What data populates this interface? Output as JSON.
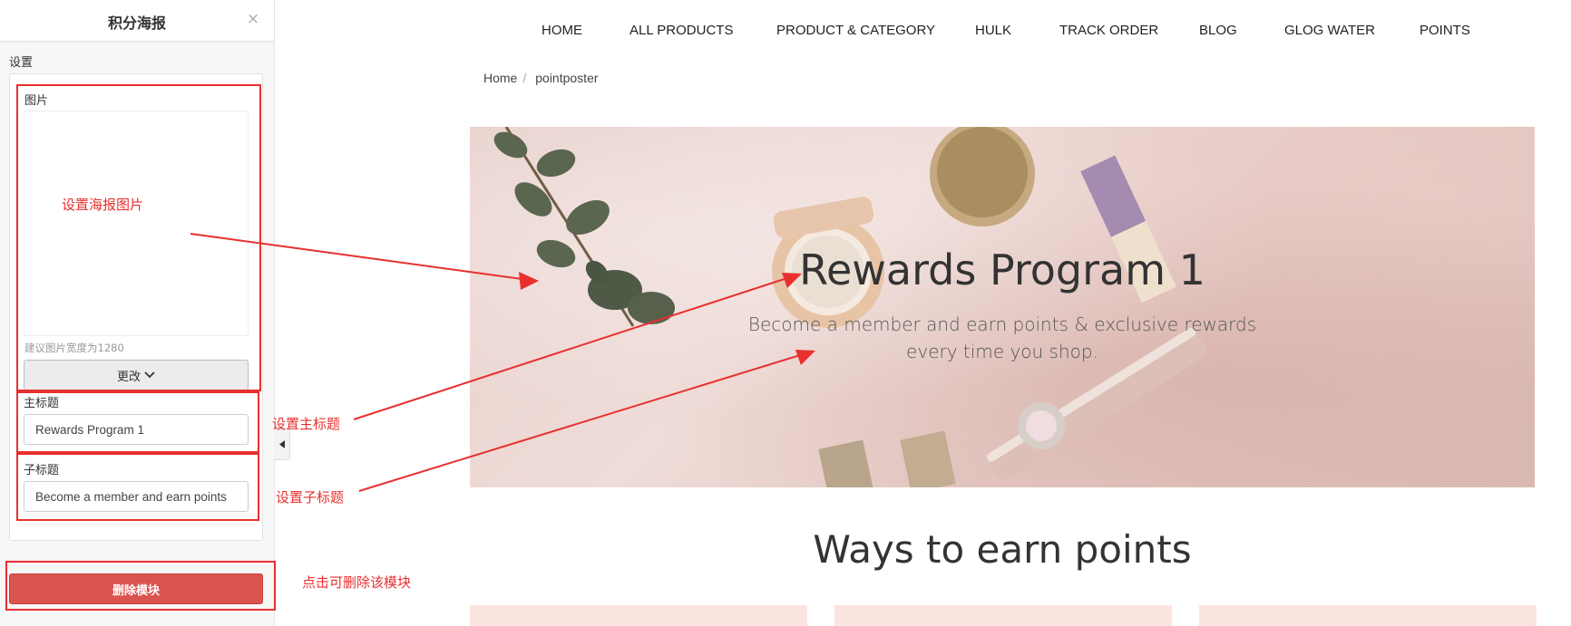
{
  "panel": {
    "title": "积分海报",
    "close_icon": "×",
    "settings_label": "设置",
    "image_label": "图片",
    "image_hint": "建议图片宽度为1280",
    "change_label": "更改",
    "main_title_label": "主标题",
    "main_title_value": "Rewards Program 1",
    "subtitle_label": "子标题",
    "subtitle_value": "Become a member and earn points",
    "delete_label": "删除模块"
  },
  "annotations": {
    "set_image": "设置海报图片",
    "set_main_title": "设置主标题",
    "set_subtitle": "设置子标题",
    "delete_hint": "点击可删除该模块",
    "color": "#e8302f"
  },
  "nav": [
    "HOME",
    "ALL PRODUCTS",
    "PRODUCT & CATEGORY",
    "HULK",
    "TRACK ORDER",
    "BLOG",
    "GLOG WATER",
    "POINTS"
  ],
  "breadcrumb": {
    "home": "Home",
    "sep": "/",
    "current": "pointposter"
  },
  "banner": {
    "title": "Rewards Program 1",
    "subtitle": "Become a member and earn points & exclusive rewards every time you shop."
  },
  "section_title": "Ways to earn points",
  "colors": {
    "delete_button": "#d9534f",
    "card_bg": "#fce4e1"
  }
}
